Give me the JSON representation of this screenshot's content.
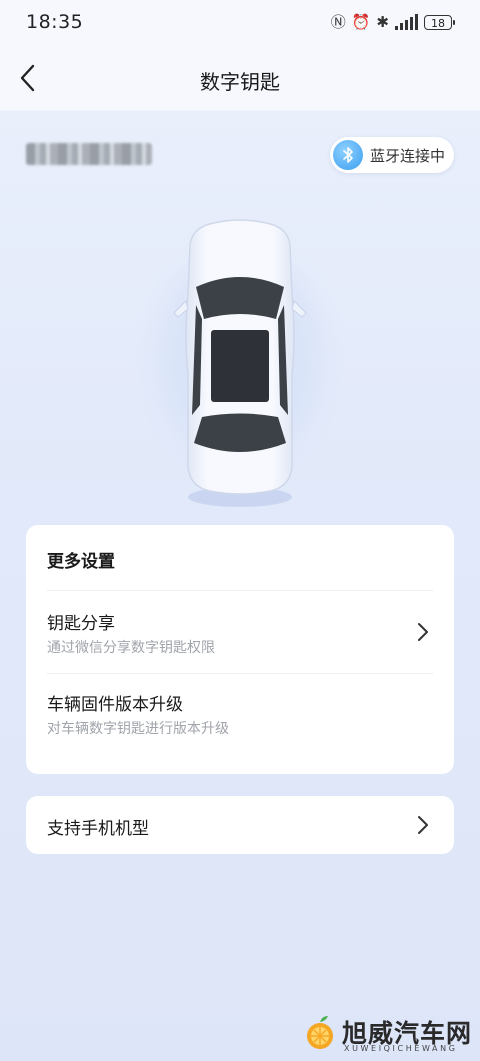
{
  "status_bar": {
    "time": "18:35",
    "battery": "18"
  },
  "header": {
    "title": "数字钥匙"
  },
  "vehicle": {
    "bluetooth_status": "蓝牙连接中"
  },
  "settings": {
    "section_title": "更多设置",
    "items": [
      {
        "title": "钥匙分享",
        "subtitle": "通过微信分享数字钥匙权限"
      },
      {
        "title": "车辆固件版本升级",
        "subtitle": "对车辆数字钥匙进行版本升级"
      }
    ]
  },
  "support": {
    "label": "支持手机机型"
  },
  "watermark": {
    "name_cn": "旭威汽车网",
    "name_en": "XUWEIQICHEWANG"
  },
  "colors": {
    "accent": "#3a9ff0",
    "card_bg": "#ffffff",
    "page_bg": "#e3eafa"
  }
}
